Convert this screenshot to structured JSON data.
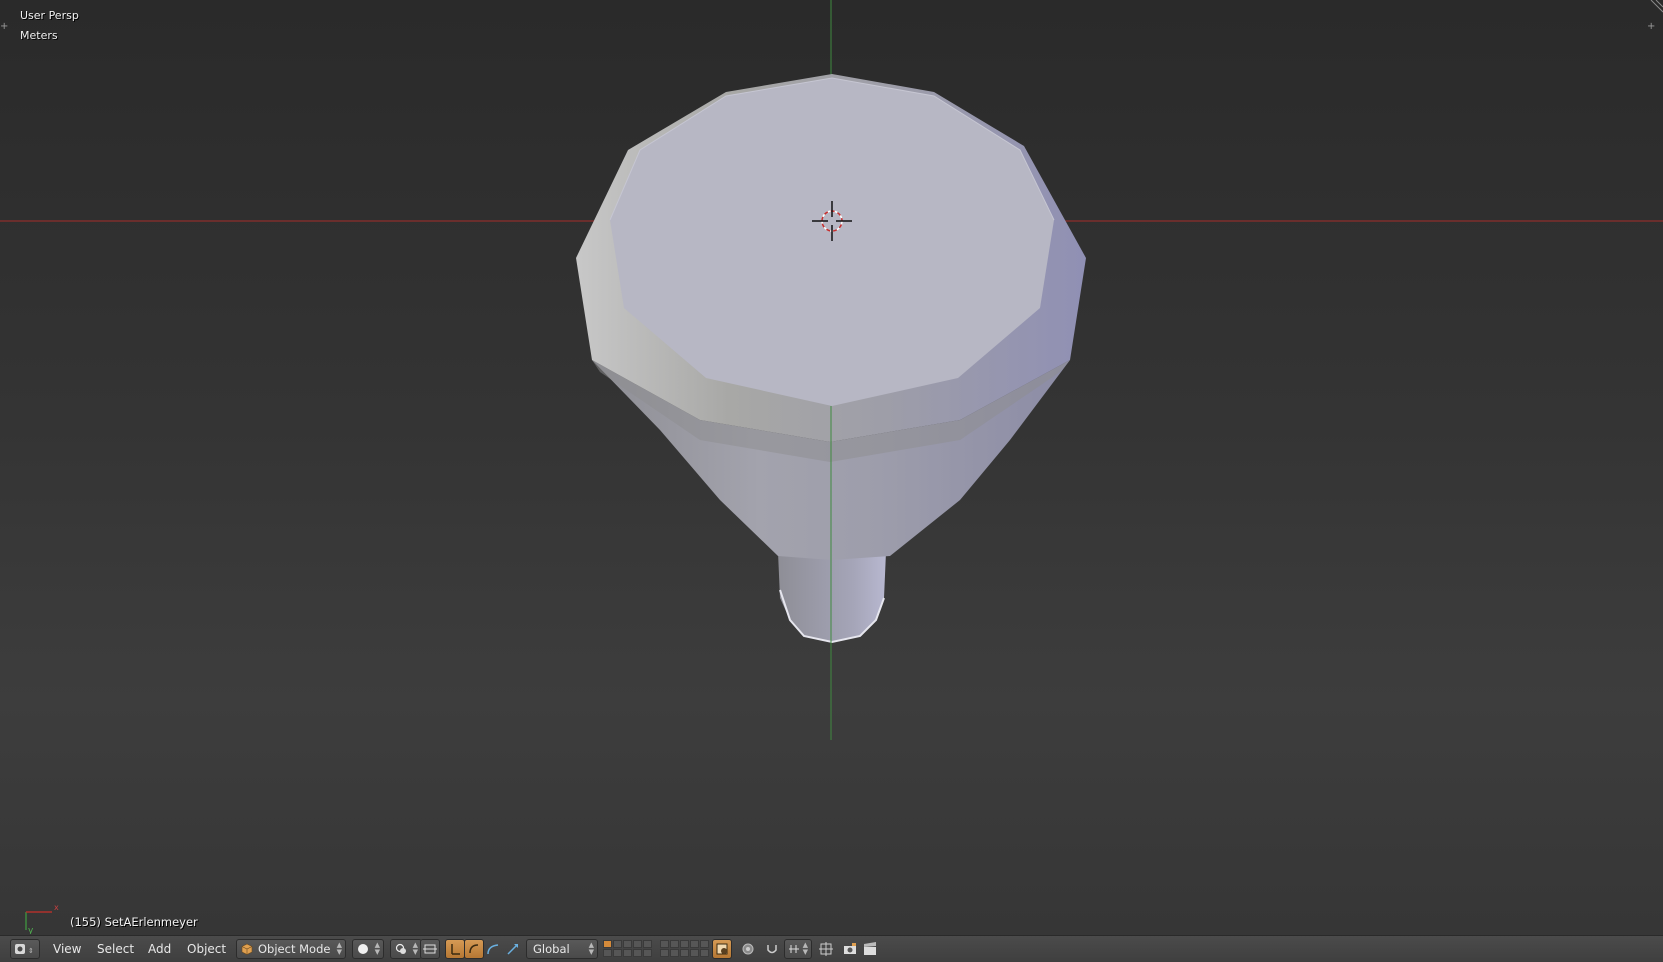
{
  "viewport": {
    "view_name": "User Persp",
    "units": "Meters",
    "object_info": "(155) SetAErlenmeyer",
    "axis_x_label": "x",
    "axis_y_label": "y"
  },
  "header": {
    "menus": {
      "view": "View",
      "select": "Select",
      "add": "Add",
      "object": "Object"
    },
    "mode_dropdown": {
      "value": "Object Mode",
      "icon": "cube-icon"
    },
    "orientation_dropdown": {
      "value": "Global"
    }
  },
  "colors": {
    "x_axis": "#b0302c",
    "y_axis": "#3f8a3f",
    "mesh_top": "#b9b9c6",
    "active_button": "#c98a44"
  }
}
